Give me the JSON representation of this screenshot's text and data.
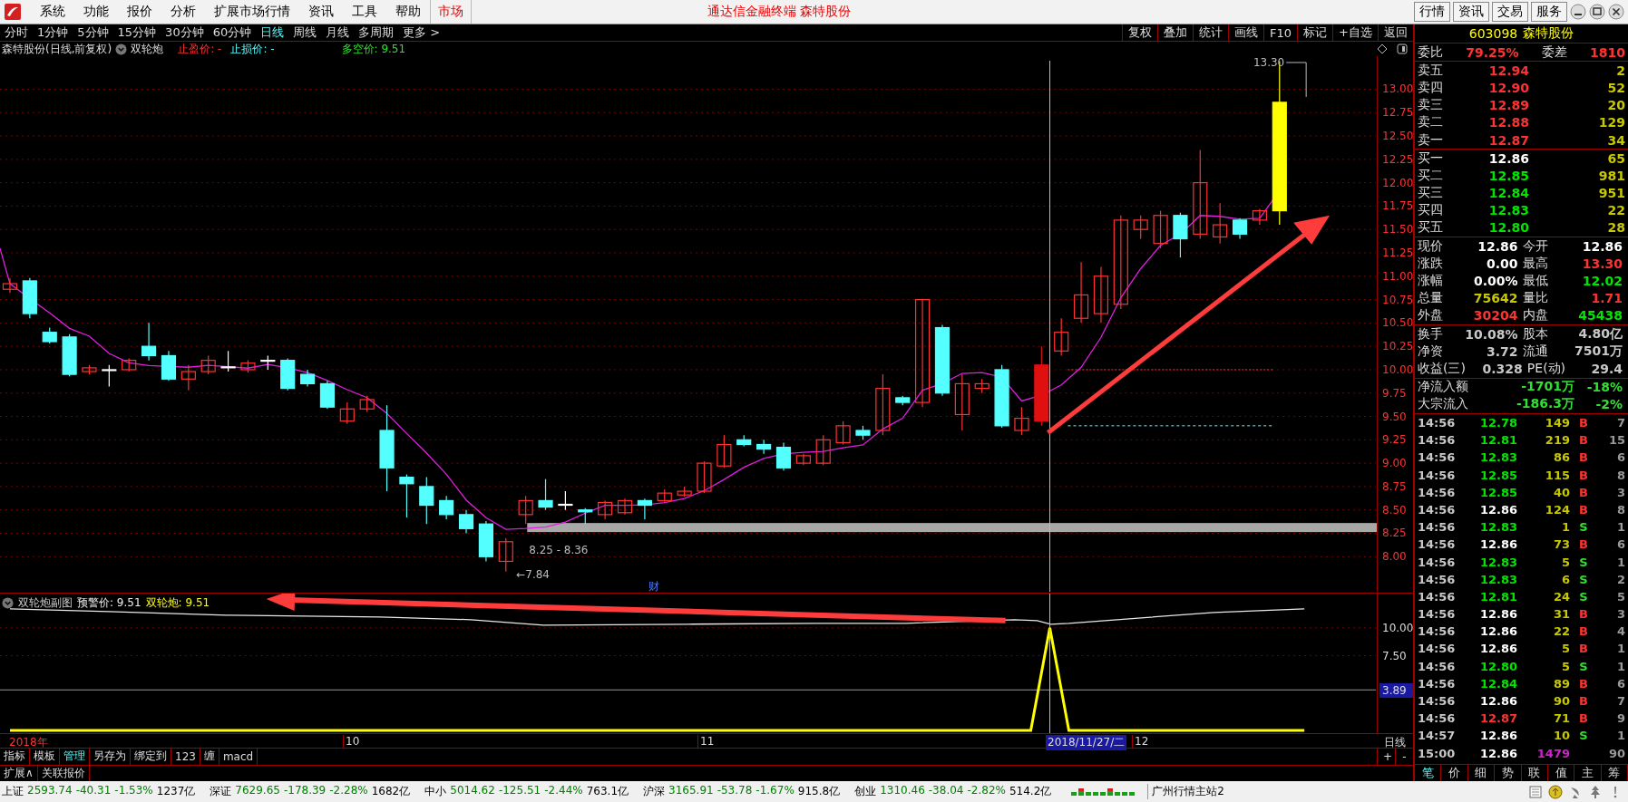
{
  "menu": {
    "items": [
      {
        "label": "系统"
      },
      {
        "label": "功能"
      },
      {
        "label": "报价"
      },
      {
        "label": "分析"
      },
      {
        "label": "扩展市场行情"
      },
      {
        "label": "资讯"
      },
      {
        "label": "工具"
      },
      {
        "label": "帮助"
      }
    ],
    "market_button": "市场",
    "title": "通达信金融终端 森特股份",
    "right_buttons": [
      "行情",
      "资讯",
      "交易",
      "服务"
    ]
  },
  "periods": [
    {
      "label": "分时",
      "selected": false
    },
    {
      "label": "1分钟",
      "selected": false
    },
    {
      "label": "5分钟",
      "selected": false
    },
    {
      "label": "15分钟",
      "selected": false
    },
    {
      "label": "30分钟",
      "selected": false
    },
    {
      "label": "60分钟",
      "selected": false
    },
    {
      "label": "日线",
      "selected": true
    },
    {
      "label": "周线",
      "selected": false
    },
    {
      "label": "月线",
      "selected": false
    },
    {
      "label": "多周期",
      "selected": false
    },
    {
      "label": "更多 >",
      "selected": false
    }
  ],
  "chart_tools": [
    "复权",
    "叠加",
    "统计",
    "画线",
    "F10",
    "标记",
    "+自选",
    "返回"
  ],
  "chart": {
    "title": "森特股份(日线,前复权)",
    "indicator": "双轮炮",
    "take_profit": "止盈价: -",
    "stop_loss": "止损价: -",
    "long_short": "多空价: 9.51",
    "price_axis": [
      "13.00",
      "12.75",
      "12.50",
      "12.25",
      "12.00",
      "11.75",
      "11.50",
      "11.25",
      "11.00",
      "10.75",
      "10.50",
      "10.25",
      "10.00",
      "9.75",
      "9.50",
      "9.25",
      "9.00",
      "8.75",
      "8.50",
      "8.25",
      "8.00"
    ],
    "high_label": "13.30",
    "low_label": "←7.84",
    "band_label": "8.25 - 8.36",
    "marker": "财"
  },
  "sub_chart": {
    "title": "双轮炮副图",
    "warn": "预警价: 9.51",
    "value": "双轮炮: 9.51",
    "axis": [
      "10.00",
      "7.50"
    ],
    "current": "3.89"
  },
  "date_axis": {
    "year": "2018年",
    "months": [
      "10",
      "11",
      "12"
    ],
    "cursor_date": "2018/11/27/二",
    "period": "日线"
  },
  "bottom_tabs": [
    {
      "label": "指标",
      "selected": false
    },
    {
      "label": "模板",
      "selected": false
    },
    {
      "label": "管理",
      "selected": true
    },
    {
      "label": "另存为",
      "selected": false
    },
    {
      "label": "绑定到",
      "selected": false
    },
    {
      "label": "123",
      "selected": false
    },
    {
      "label": "缠",
      "selected": false
    },
    {
      "label": "macd",
      "selected": false
    }
  ],
  "zoom_buttons": [
    "+",
    "-"
  ],
  "extension_tabs": [
    "扩展∧",
    "关联报价"
  ],
  "quote": {
    "code": "603098",
    "name": "森特股份",
    "ratio": [
      {
        "label": "委比",
        "value": "79.25%"
      },
      {
        "label": "委差",
        "value": "1810"
      }
    ],
    "asks": [
      {
        "label": "卖五",
        "price": "12.94",
        "color": "#ff3232",
        "volume": "2"
      },
      {
        "label": "卖四",
        "price": "12.90",
        "color": "#ff3232",
        "volume": "52"
      },
      {
        "label": "卖三",
        "price": "12.89",
        "color": "#ff3232",
        "volume": "20"
      },
      {
        "label": "卖二",
        "price": "12.88",
        "color": "#ff3232",
        "volume": "129"
      },
      {
        "label": "卖一",
        "price": "12.87",
        "color": "#ff3232",
        "volume": "34"
      }
    ],
    "bids": [
      {
        "label": "买一",
        "price": "12.86",
        "color": "#ffffff",
        "volume": "65"
      },
      {
        "label": "买二",
        "price": "12.85",
        "color": "#00e600",
        "volume": "981"
      },
      {
        "label": "买三",
        "price": "12.84",
        "color": "#00e600",
        "volume": "951"
      },
      {
        "label": "买四",
        "price": "12.83",
        "color": "#00e600",
        "volume": "22"
      },
      {
        "label": "买五",
        "price": "12.80",
        "color": "#00e600",
        "volume": "28"
      }
    ],
    "stats": [
      [
        {
          "label": "现价",
          "value": "12.86",
          "color": "#ffffff"
        },
        {
          "label": "今开",
          "value": "12.86",
          "color": "#ffffff"
        }
      ],
      [
        {
          "label": "涨跌",
          "value": "0.00",
          "color": "#ffffff"
        },
        {
          "label": "最高",
          "value": "13.30",
          "color": "#ff3232"
        }
      ],
      [
        {
          "label": "涨幅",
          "value": "0.00%",
          "color": "#ffffff"
        },
        {
          "label": "最低",
          "value": "12.02",
          "color": "#00e600"
        }
      ],
      [
        {
          "label": "总量",
          "value": "75642",
          "color": "#c8c800"
        },
        {
          "label": "量比",
          "value": "1.71",
          "color": "#ff3232"
        }
      ],
      [
        {
          "label": "外盘",
          "value": "30204",
          "color": "#ff3232"
        },
        {
          "label": "内盘",
          "value": "45438",
          "color": "#00e600"
        }
      ]
    ],
    "info": [
      [
        {
          "label": "换手",
          "value": "10.08%"
        },
        {
          "label": "股本",
          "value": "4.80亿"
        }
      ],
      [
        {
          "label": "净资",
          "value": "3.72"
        },
        {
          "label": "流通",
          "value": "7501万"
        }
      ],
      [
        {
          "label": "收益(三)",
          "value": "0.328"
        },
        {
          "label": "PE(动)",
          "value": "29.4"
        }
      ]
    ],
    "flows": [
      {
        "label": "净流入额",
        "amount": "-1701万",
        "percent": "-18%"
      },
      {
        "label": "大宗流入",
        "amount": "-186.3万",
        "percent": "-2%"
      }
    ],
    "trades": [
      {
        "time": "14:56",
        "price": "12.78",
        "color": "#00e600",
        "volume": "149",
        "side": "B",
        "count": "7",
        "kind": "buy"
      },
      {
        "time": "14:56",
        "price": "12.81",
        "color": "#00e600",
        "volume": "219",
        "side": "B",
        "count": "15",
        "kind": "buy"
      },
      {
        "time": "14:56",
        "price": "12.83",
        "color": "#00e600",
        "volume": "86",
        "side": "B",
        "count": "6",
        "kind": "buy"
      },
      {
        "time": "14:56",
        "price": "12.85",
        "color": "#00e600",
        "volume": "115",
        "side": "B",
        "count": "8",
        "kind": "buy"
      },
      {
        "time": "14:56",
        "price": "12.85",
        "color": "#00e600",
        "volume": "40",
        "side": "B",
        "count": "3",
        "kind": "buy"
      },
      {
        "time": "14:56",
        "price": "12.86",
        "color": "#ffffff",
        "volume": "124",
        "side": "B",
        "count": "8",
        "kind": "buy"
      },
      {
        "time": "14:56",
        "price": "12.83",
        "color": "#00e600",
        "volume": "1",
        "side": "S",
        "count": "1",
        "kind": "sell"
      },
      {
        "time": "14:56",
        "price": "12.86",
        "color": "#ffffff",
        "volume": "73",
        "side": "B",
        "count": "6",
        "kind": "buy"
      },
      {
        "time": "14:56",
        "price": "12.83",
        "color": "#00e600",
        "volume": "5",
        "side": "S",
        "count": "1",
        "kind": "sell"
      },
      {
        "time": "14:56",
        "price": "12.83",
        "color": "#00e600",
        "volume": "6",
        "side": "S",
        "count": "2",
        "kind": "sell"
      },
      {
        "time": "14:56",
        "price": "12.81",
        "color": "#00e600",
        "volume": "24",
        "side": "S",
        "count": "5",
        "kind": "sell"
      },
      {
        "time": "14:56",
        "price": "12.86",
        "color": "#ffffff",
        "volume": "31",
        "side": "B",
        "count": "3",
        "kind": "buy"
      },
      {
        "time": "14:56",
        "price": "12.86",
        "color": "#ffffff",
        "volume": "22",
        "side": "B",
        "count": "4",
        "kind": "buy"
      },
      {
        "time": "14:56",
        "price": "12.86",
        "color": "#ffffff",
        "volume": "5",
        "side": "B",
        "count": "1",
        "kind": "buy"
      },
      {
        "time": "14:56",
        "price": "12.80",
        "color": "#00e600",
        "volume": "5",
        "side": "S",
        "count": "1",
        "kind": "sell"
      },
      {
        "time": "14:56",
        "price": "12.84",
        "color": "#00e600",
        "volume": "89",
        "side": "B",
        "count": "6",
        "kind": "buy"
      },
      {
        "time": "14:56",
        "price": "12.86",
        "color": "#ffffff",
        "volume": "90",
        "side": "B",
        "count": "7",
        "kind": "buy"
      },
      {
        "time": "14:56",
        "price": "12.87",
        "color": "#ff3232",
        "volume": "71",
        "side": "B",
        "count": "9",
        "kind": "buy"
      },
      {
        "time": "14:57",
        "price": "12.86",
        "color": "#ffffff",
        "volume": "10",
        "side": "S",
        "count": "1",
        "kind": "sell"
      },
      {
        "time": "15:00",
        "price": "12.86",
        "color": "#ffffff",
        "volume": "1479",
        "count": "90",
        "kind": "summary"
      }
    ],
    "tabs": [
      {
        "label": "笔",
        "selected": true
      },
      {
        "label": "价",
        "selected": false
      },
      {
        "label": "细",
        "selected": false
      },
      {
        "label": "势",
        "selected": false
      },
      {
        "label": "联",
        "selected": false
      },
      {
        "label": "值",
        "selected": false
      },
      {
        "label": "主",
        "selected": false
      },
      {
        "label": "筹",
        "selected": false
      }
    ]
  },
  "status_bar": {
    "indices": [
      {
        "name": "上证",
        "value": "2593.74",
        "change": "-40.31",
        "percent": "-1.53%",
        "turnover": "1237亿"
      },
      {
        "name": "深证",
        "value": "7629.65",
        "change": "-178.39",
        "percent": "-2.28%",
        "turnover": "1682亿"
      },
      {
        "name": "中小",
        "value": "5014.62",
        "change": "-125.51",
        "percent": "-2.44%",
        "turnover": "763.1亿"
      },
      {
        "name": "沪深",
        "value": "3165.91",
        "change": "-53.78",
        "percent": "-1.67%",
        "turnover": "915.8亿"
      },
      {
        "name": "创业",
        "value": "1310.46",
        "change": "-38.04",
        "percent": "-2.82%",
        "turnover": "514.2亿"
      }
    ],
    "server": "广州行情主站2"
  }
}
